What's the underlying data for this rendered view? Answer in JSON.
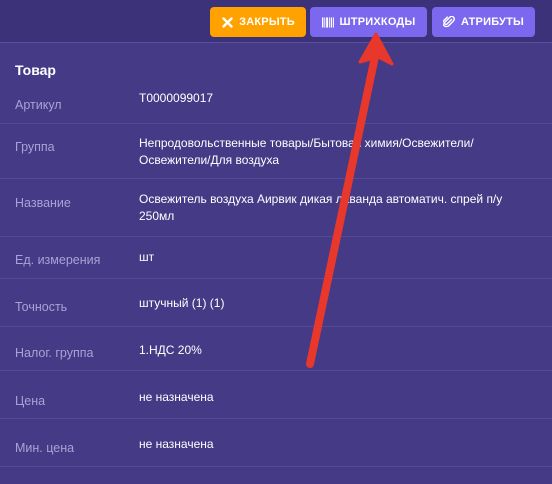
{
  "toolbar": {
    "close_label": "ЗАКРЫТЬ",
    "barcodes_label": "ШТРИХКОДЫ",
    "attributes_label": "АТРИБУТЫ"
  },
  "product": {
    "section_title": "Товар",
    "fields": [
      {
        "label": "Артикул",
        "value": "T0000099017"
      },
      {
        "label": "Группа",
        "value": "Непродовольственные товары/Бытовая химия/Освежители/Освежители/Для воздуха"
      },
      {
        "label": "Название",
        "value": "Освежитель воздуха Аирвик дикая лаванда автоматич. спрей п/у 250мл"
      },
      {
        "label": "Ед. измерения",
        "value": "шт"
      },
      {
        "label": "Точность",
        "value": "штучный (1) (1)"
      },
      {
        "label": "Налог. группа",
        "value": "1.НДС 20%"
      },
      {
        "label": "Цена",
        "value": "не назначена"
      },
      {
        "label": "Мин. цена",
        "value": "не назначена"
      }
    ]
  },
  "colors": {
    "background": "#453a86",
    "topbar": "#3b327a",
    "close_button": "#ffa200",
    "action_button": "#7b68ee",
    "label_text": "#a9a2d6",
    "annotation_arrow": "#e8372b"
  }
}
